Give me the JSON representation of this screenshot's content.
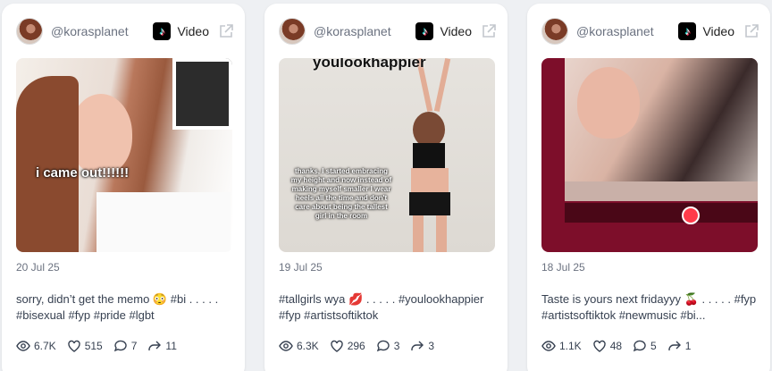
{
  "cards": [
    {
      "handle": "@korasplanet",
      "type_label": "Video",
      "overlay_text": "i came out!!!!!!",
      "date": "20 Jul 25",
      "description": "sorry, didn’t get the memo 😳 #bi . . . . . #bisexual #fyp #pride #lgbt",
      "views": "6.7K",
      "likes": "515",
      "comments": "7",
      "shares": "11"
    },
    {
      "handle": "@korasplanet",
      "type_label": "Video",
      "overlay_top": "youlookhappier",
      "overlay_text": "thanks, I started embracing my height and now instead of making myself smaller I wear heels all the time and don't care about being the tallest girl in the room",
      "date": "19 Jul 25",
      "description": "#tallgirls wya 💋 . . . . . #youlookhappier #fyp #artistsoftiktok",
      "views": "6.3K",
      "likes": "296",
      "comments": "3",
      "shares": "3"
    },
    {
      "handle": "@korasplanet",
      "type_label": "Video",
      "date": "18 Jul 25",
      "description": "Taste is yours next fridayyy 🍒 . . . . . #fyp #artistsoftiktok #newmusic #bi...",
      "views": "1.1K",
      "likes": "48",
      "comments": "5",
      "shares": "1"
    }
  ],
  "icons": {
    "platform": "tiktok-icon",
    "external": "external-link-icon",
    "views": "eye-icon",
    "likes": "heart-icon",
    "comments": "comment-icon",
    "shares": "share-icon"
  },
  "colors": {
    "card_bg": "#ffffff",
    "page_bg": "#eef0f3",
    "muted_text": "#6b7280",
    "body_text": "#374151"
  }
}
